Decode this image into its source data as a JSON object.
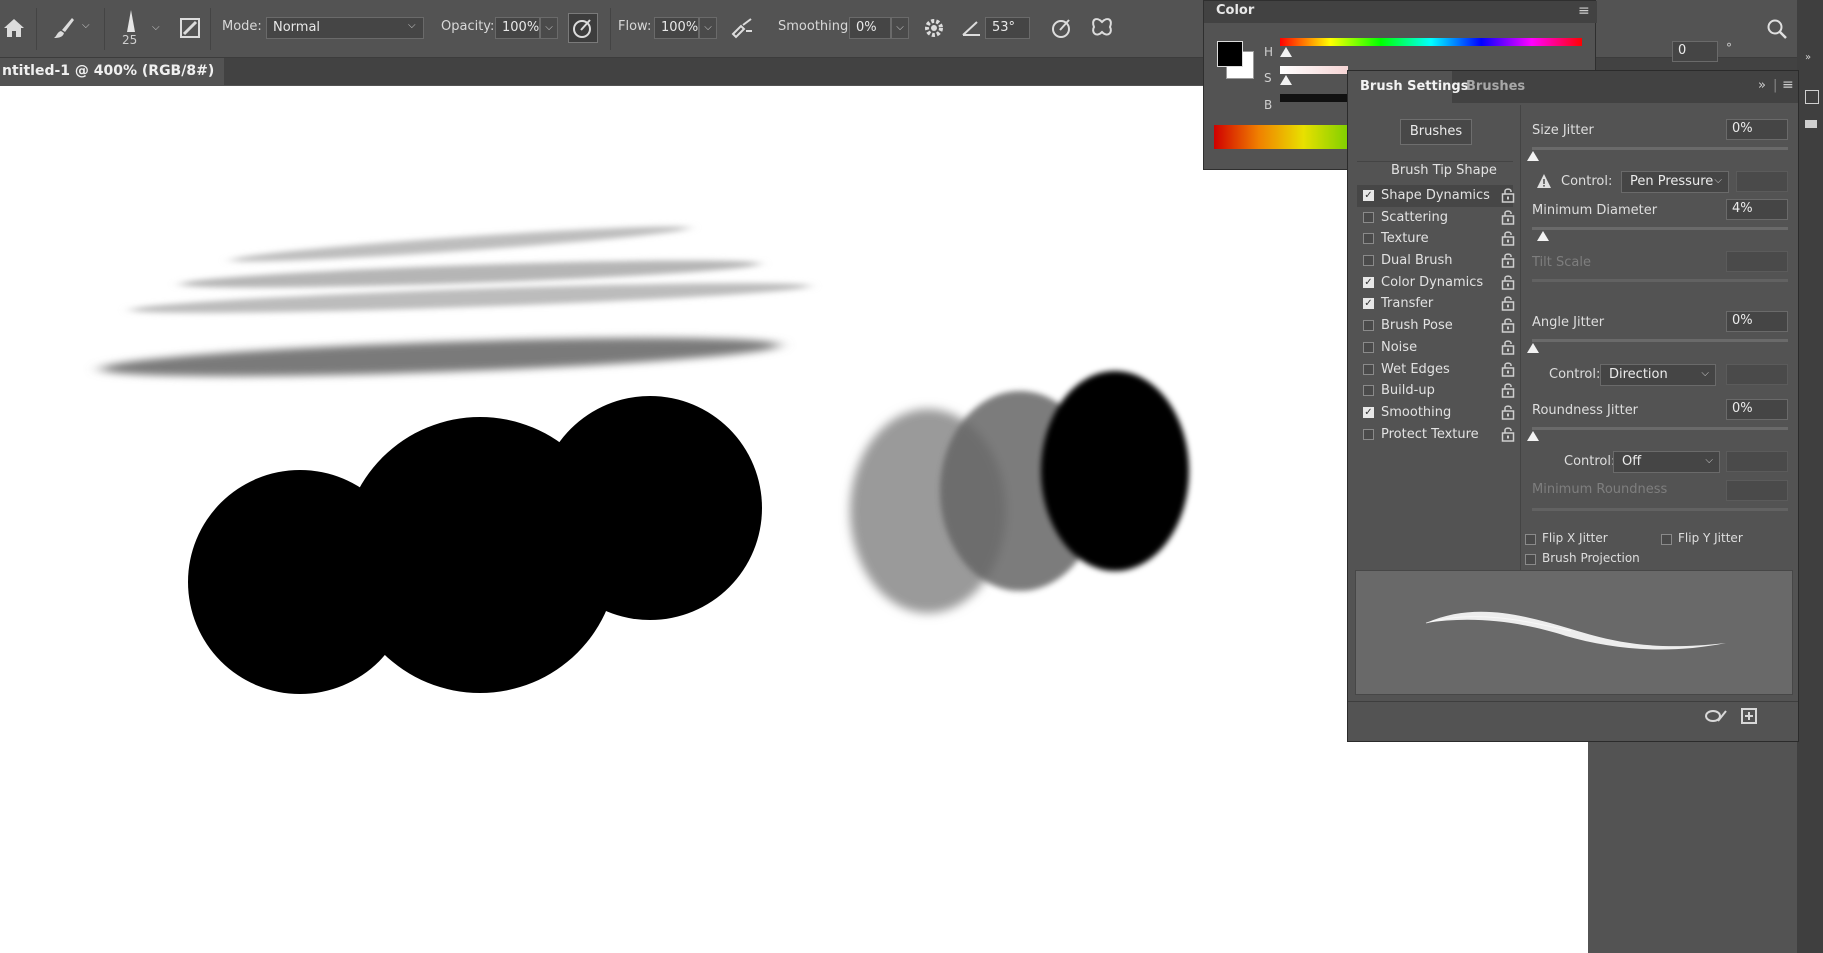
{
  "options_bar": {
    "brush_size": "25",
    "mode_label": "Mode:",
    "mode_value": "Normal",
    "opacity_label": "Opacity:",
    "opacity_value": "100%",
    "flow_label": "Flow:",
    "flow_value": "100%",
    "smoothing_label": "Smoothing:",
    "smoothing_value": "0%",
    "angle_value": "53°"
  },
  "document_tab": {
    "title": "ntitled-1 @ 400% (RGB/8#) *",
    "close_glyph": "×"
  },
  "color_panel": {
    "title": "Color",
    "h_label": "H",
    "s_label": "S",
    "b_label": "B",
    "h_value": "0",
    "degree_unit": "°"
  },
  "brush_settings": {
    "tab_active": "Brush Settings",
    "tab_other": "Brushes",
    "brushes_button": "Brushes",
    "tip_shape_label": "Brush Tip Shape",
    "options": [
      {
        "label": "Shape Dynamics",
        "checked": true
      },
      {
        "label": "Scattering",
        "checked": false
      },
      {
        "label": "Texture",
        "checked": false
      },
      {
        "label": "Dual Brush",
        "checked": false
      },
      {
        "label": "Color Dynamics",
        "checked": true
      },
      {
        "label": "Transfer",
        "checked": true
      },
      {
        "label": "Brush Pose",
        "checked": false
      },
      {
        "label": "Noise",
        "checked": false
      },
      {
        "label": "Wet Edges",
        "checked": false
      },
      {
        "label": "Build-up",
        "checked": false
      },
      {
        "label": "Smoothing",
        "checked": true
      },
      {
        "label": "Protect Texture",
        "checked": false
      }
    ],
    "size_jitter_label": "Size Jitter",
    "size_jitter_value": "0%",
    "control_label": "Control:",
    "control1_value": "Pen Pressure",
    "min_diameter_label": "Minimum Diameter",
    "min_diameter_value": "4%",
    "tilt_scale_label": "Tilt Scale",
    "angle_jitter_label": "Angle Jitter",
    "angle_jitter_value": "0%",
    "control2_value": "Direction",
    "roundness_jitter_label": "Roundness Jitter",
    "roundness_jitter_value": "0%",
    "control3_value": "Off",
    "min_roundness_label": "Minimum Roundness",
    "flip_x_label": "Flip X Jitter",
    "flip_y_label": "Flip Y Jitter",
    "brush_projection_label": "Brush Projection"
  }
}
